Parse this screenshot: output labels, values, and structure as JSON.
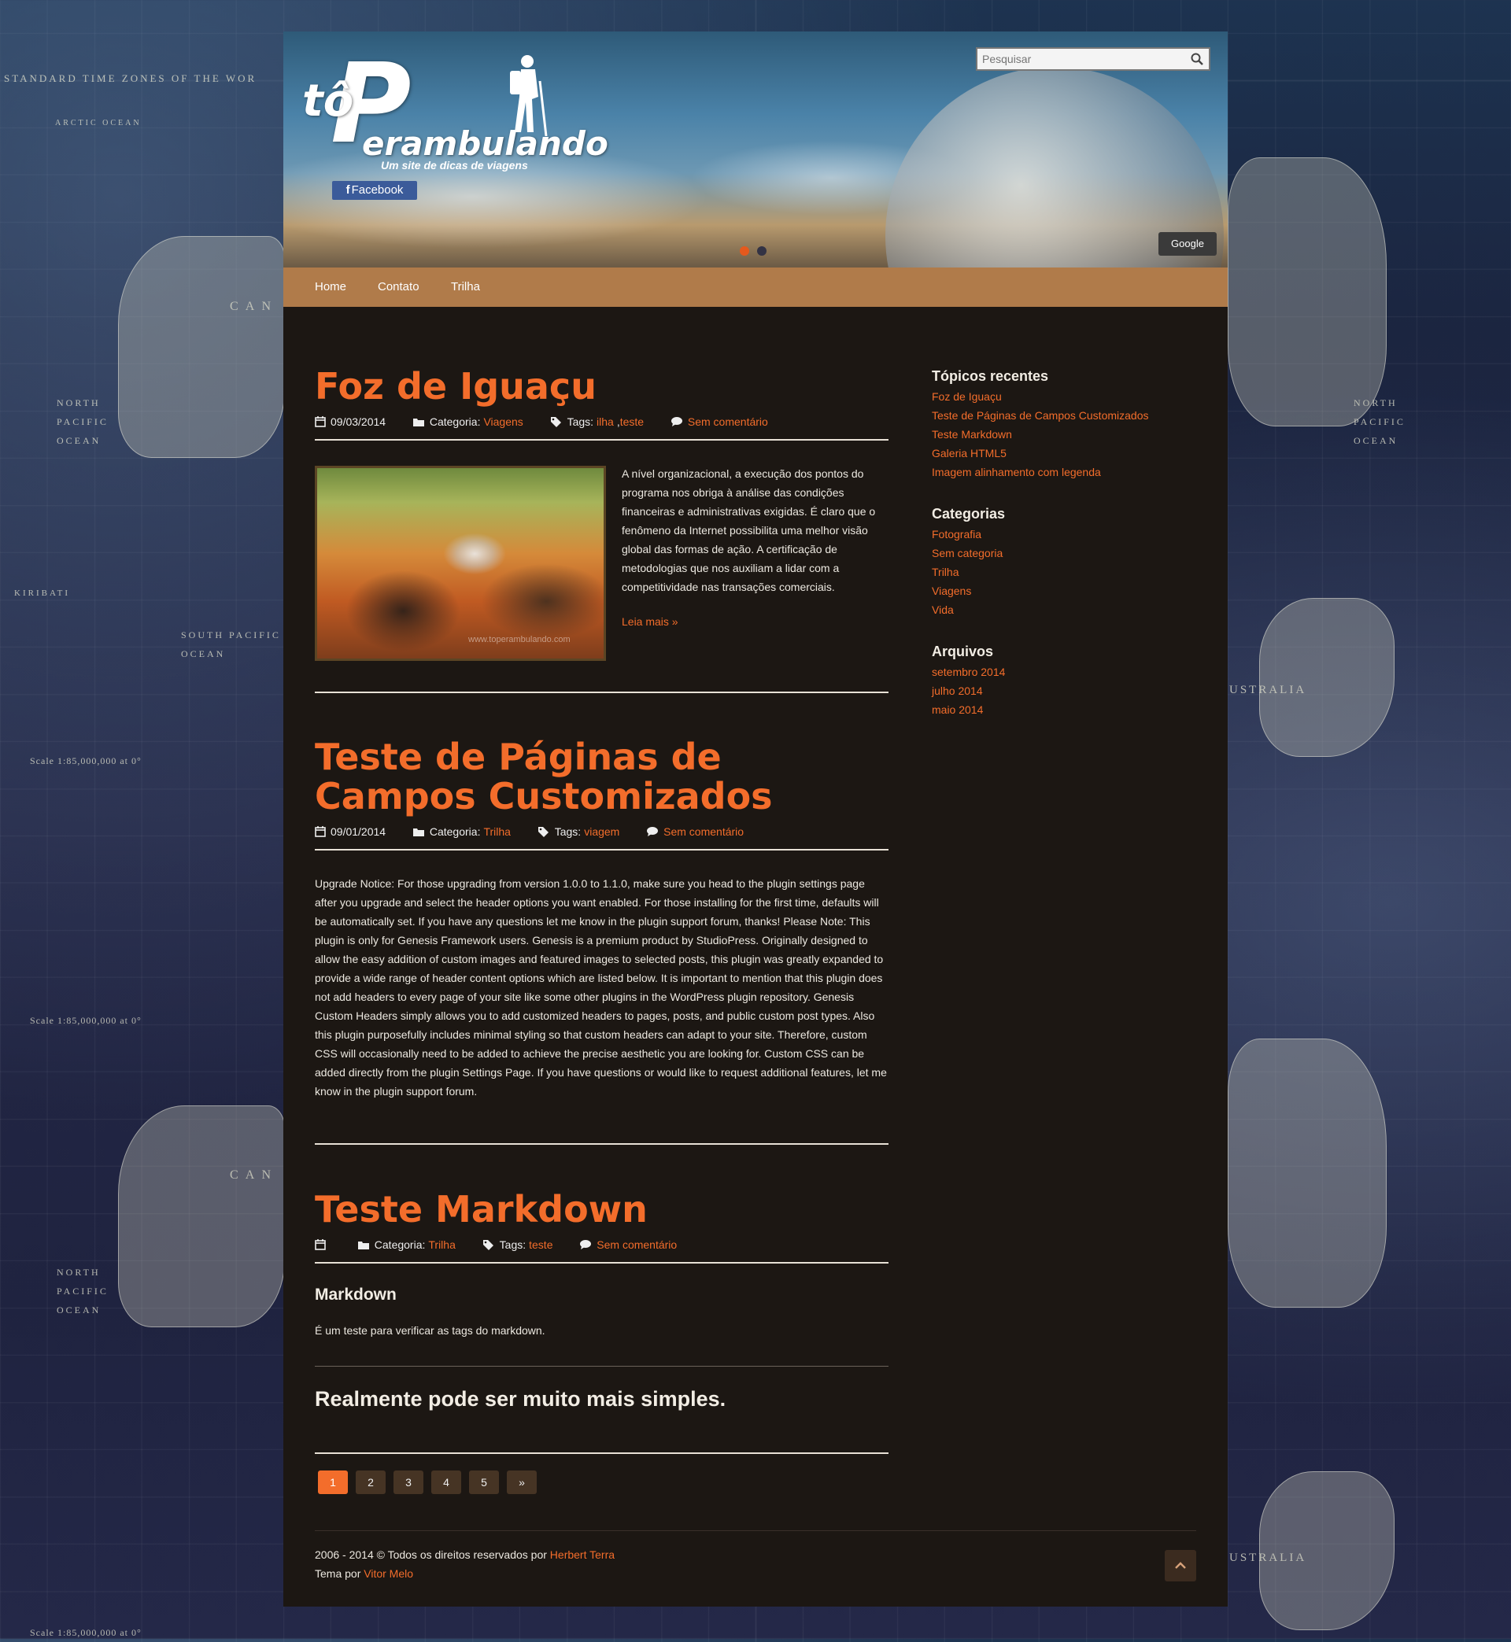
{
  "background": {
    "label_time_zones": "STANDARD TIME ZONES OF THE WOR",
    "label_arctic": "ARCTIC OCEAN",
    "label_north_pacific": "NORTH\nPACIFIC\nOCEAN",
    "label_south_pacific": "SOUTH PACIFIC\nOCEAN",
    "label_can": "C A N",
    "label_australia": "USTRALIA",
    "label_kiribati": "KIRIBATI",
    "label_scale": "Scale 1:85,000,000 at 0°"
  },
  "header": {
    "logo_small": "tô",
    "logo_letter": "P",
    "logo_rest": "erambulando",
    "tagline": "Um site de dicas de viagens",
    "facebook_label": "Facebook",
    "search_placeholder": "Pesquisar",
    "google_label": "Google",
    "slider_dots": 2,
    "slider_active": 1
  },
  "nav": {
    "items": [
      "Home",
      "Contato",
      "Trilha"
    ]
  },
  "posts": [
    {
      "title": "Foz de Iguaçu",
      "date": "09/03/2014",
      "category_label": "Categoria:",
      "category": "Viagens",
      "tags_label": "Tags:",
      "tags": [
        "ilha",
        "teste"
      ],
      "comments": "Sem comentário",
      "excerpt": "A nível organizacional, a execução dos pontos do programa nos obriga à análise das condições financeiras e administrativas exigidas. É claro que o fenômeno da Internet possibilita uma melhor visão global das formas de ação. A certificação de metodologias que nos auxiliam a lidar com a competitividade nas transações comerciais.",
      "read_more": "Leia mais »",
      "image_caption": "www.toperambulando.com"
    },
    {
      "title": "Teste de Páginas de Campos Customizados",
      "date": "09/01/2014",
      "category_label": "Categoria:",
      "category": "Trilha",
      "tags_label": "Tags:",
      "tags": [
        "viagem"
      ],
      "comments": "Sem comentário",
      "body": "Upgrade Notice: For those upgrading from version 1.0.0 to 1.1.0, make sure you head to the plugin settings page after you upgrade and select the header options you want enabled. For those installing for the first time, defaults will be automatically set. If you have any questions let me know in the plugin support forum, thanks! Please Note: This plugin is only for Genesis Framework users. Genesis is a premium product by StudioPress. Originally designed to allow the easy addition of custom images and featured images to selected posts, this plugin was greatly expanded to provide a wide range of header content options which are listed below. It is important to mention that this plugin does not add headers to every page of your site like some other plugins in the WordPress plugin repository. Genesis Custom Headers simply allows you to add customized headers to pages, posts, and public custom post types. Also this plugin purposefully includes minimal styling so that custom headers can adapt to your site. Therefore, custom CSS will occasionally need to be added to achieve the precise aesthetic you are looking for. Custom CSS can be added directly from the plugin Settings Page. If you have questions or would like to request additional features, let me know in the plugin support forum."
    },
    {
      "title": "Teste Markdown",
      "date": "",
      "category_label": "Categoria:",
      "category": "Trilha",
      "tags_label": "Tags:",
      "tags": [
        "teste"
      ],
      "comments": "Sem comentário",
      "heading": "Markdown",
      "paragraph": "É um teste para verificar as tags do markdown.",
      "subheading": "Realmente pode ser muito mais simples."
    }
  ],
  "pagination": {
    "pages": [
      "1",
      "2",
      "3",
      "4",
      "5",
      "»"
    ],
    "active": "1"
  },
  "sidebar": {
    "recent_title": "Tópicos recentes",
    "recent": [
      "Foz de Iguaçu",
      "Teste de Páginas de Campos Customizados",
      "Teste Markdown",
      "Galeria HTML5",
      "Imagem alinhamento com legenda"
    ],
    "categories_title": "Categorias",
    "categories": [
      "Fotografia",
      "Sem categoria",
      "Trilha",
      "Viagens",
      "Vida"
    ],
    "archives_title": "Arquivos",
    "archives": [
      "setembro 2014",
      "julho 2014",
      "maio 2014"
    ]
  },
  "footer": {
    "copyright_prefix": "2006 - 2014 © Todos os direitos reservados por",
    "author": "Herbert Terra",
    "theme_prefix": "Tema por",
    "theme_author": "Vitor Melo"
  },
  "colors": {
    "accent": "#f36d2b",
    "nav": "#b07b4a",
    "content_bg": "#1c1713",
    "facebook": "#3b5b9a"
  },
  "icons": [
    "search-icon",
    "calendar-icon",
    "folder-icon",
    "tags-icon",
    "comment-icon",
    "facebook-icon",
    "chevron-up-icon",
    "hiker-icon"
  ]
}
